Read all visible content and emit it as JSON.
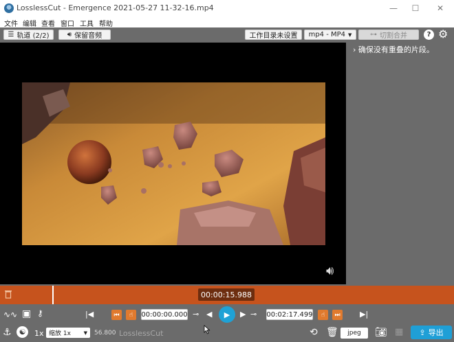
{
  "window": {
    "title": "LosslessCut - Emergence 2021-05-27 11-32-16.mp4",
    "min_glyph": "—",
    "max_glyph": "☐",
    "close_glyph": "✕"
  },
  "menu": [
    "文件",
    "编辑",
    "查看",
    "窗口",
    "工具",
    "帮助"
  ],
  "toolbar": {
    "tracks_label": "轨道 (2/2)",
    "keep_audio_label": "保留音频",
    "workdir_label": "工作目录未设置",
    "format_label": "mp4 - MP4",
    "merge_label": "切割合并",
    "help_glyph": "?",
    "settings_glyph": "⚙"
  },
  "right_panel": {
    "hint": "确保没有重叠的片段。"
  },
  "timeline": {
    "current_time": "00:00:15.988"
  },
  "controls": {
    "cut_start": "00:00:00.000",
    "cut_end": "00:02:17.499",
    "playback_rate": "1x",
    "zoom_label": "缩放 1x",
    "zoom_value": "56.800",
    "app_name": "LosslessCut",
    "capture_format": "jpeg",
    "export_label": "导出"
  },
  "colors": {
    "timeline": "#c6531d",
    "accent": "#1fa2d6",
    "orange_button": "#e07a2e",
    "background": "#6b6b6b"
  }
}
